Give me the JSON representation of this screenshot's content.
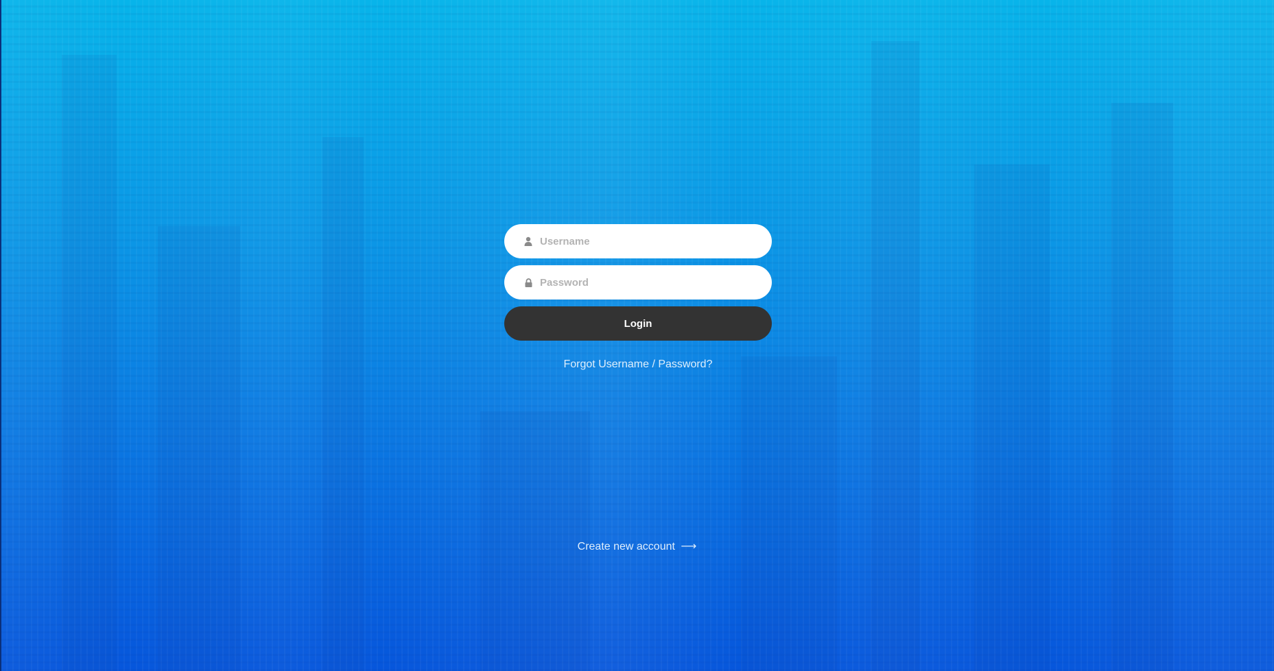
{
  "login_form": {
    "username_placeholder": "Username",
    "password_placeholder": "Password",
    "login_label": "Login",
    "forgot_label": "Forgot Username / Password?"
  },
  "footer": {
    "create_account_label": "Create new account",
    "arrow_glyph": "⟶"
  },
  "icons": {
    "username": "user-icon",
    "password": "lock-icon",
    "create_account": "long-arrow-right-icon"
  },
  "colors": {
    "background_top": "#07b4ea",
    "background_bottom": "#0656dc",
    "button": "#333333",
    "field": "#ffffff",
    "link": "#dfeefc",
    "placeholder": "#b3b3b3"
  }
}
